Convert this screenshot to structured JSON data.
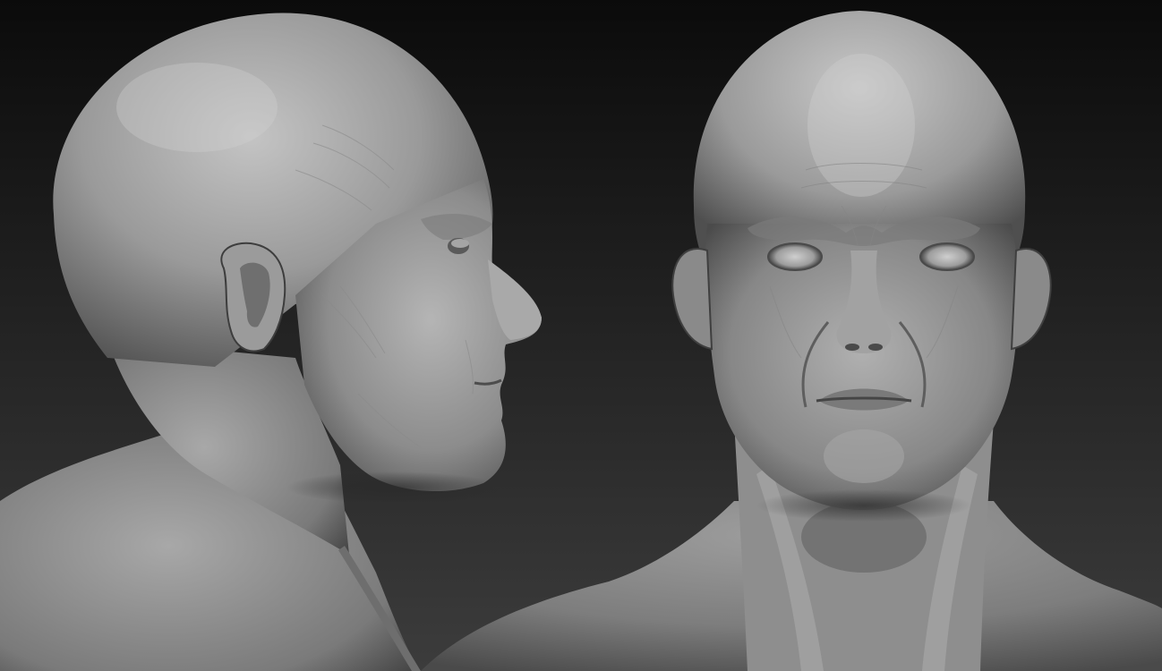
{
  "scene": {
    "background_top": "#0b0b0b",
    "background_bottom": "#3c3c3c",
    "clay_light": "#bdbdbd",
    "clay_mid": "#8e8e8e",
    "clay_dark": "#4a4a4a",
    "views": [
      {
        "id": "side",
        "name": "side-profile-view"
      },
      {
        "id": "front",
        "name": "front-view"
      }
    ]
  }
}
